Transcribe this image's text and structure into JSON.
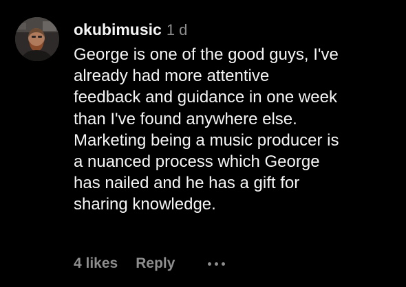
{
  "comment": {
    "username": "okubimusic",
    "timestamp": "1 d",
    "avatar_icon": "user-avatar-photo",
    "lines": [
      "George is one of the good guys, I've",
      "already had more attentive",
      "feedback and guidance in one week",
      "than I've found anywhere else.",
      "Marketing being a music producer is",
      "a nuanced process which George",
      "has nailed and he has a gift for",
      "sharing knowledge."
    ],
    "likes_label": "4 likes",
    "reply_label": "Reply",
    "more_icon": "more-options-icon"
  },
  "colors": {
    "background": "#000000",
    "primary_text": "#f5f5f5",
    "secondary_text": "#8e8e8e"
  }
}
